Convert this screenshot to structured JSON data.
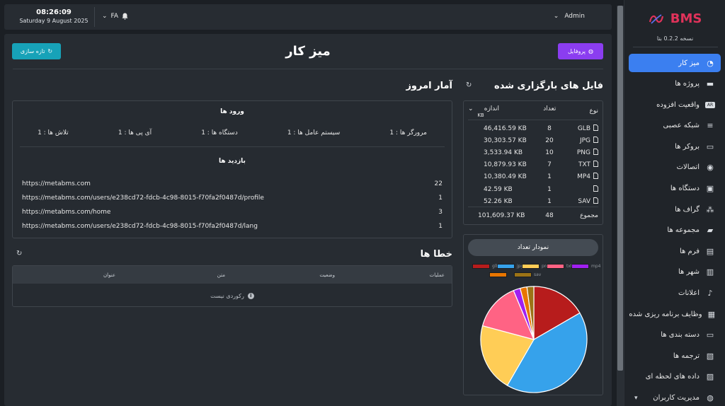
{
  "app": {
    "brand": "BMS",
    "version_label": "نسخه 0.2.2 بتا"
  },
  "topbar": {
    "time": "08:26:09",
    "date": "Saturday 9 August 2025",
    "lang": "FA",
    "user": "Admin"
  },
  "sidebar": {
    "items": [
      {
        "label": "میز کار",
        "icon": "pie-chart-icon",
        "glyph": "◔",
        "active": true
      },
      {
        "label": "پروژه ها",
        "icon": "briefcase-icon",
        "glyph": "▬"
      },
      {
        "label": "واقعیت افزوده",
        "icon": "ar-icon",
        "glyph": "AR"
      },
      {
        "label": "شبکه عصبی",
        "icon": "database-icon",
        "glyph": "≡"
      },
      {
        "label": "بروکر ها",
        "icon": "router-icon",
        "glyph": "▭"
      },
      {
        "label": "اتصالات",
        "icon": "connection-icon",
        "glyph": "◉"
      },
      {
        "label": "دستگاه ها",
        "icon": "device-icon",
        "glyph": "▣"
      },
      {
        "label": "گراف ها",
        "icon": "graph-icon",
        "glyph": "⁂"
      },
      {
        "label": "مجموعه ها",
        "icon": "folder-icon",
        "glyph": "▰"
      },
      {
        "label": "فرم ها",
        "icon": "form-icon",
        "glyph": "▤"
      },
      {
        "label": "شهر ها",
        "icon": "map-icon",
        "glyph": "▥"
      },
      {
        "label": "اعلانات",
        "icon": "bell-icon",
        "glyph": "♪"
      },
      {
        "label": "وظایف برنامه ریزی شده",
        "icon": "calendar-icon",
        "glyph": "▦"
      },
      {
        "label": "دسته بندی ها",
        "icon": "folder-open-icon",
        "glyph": "▭"
      },
      {
        "label": "ترجمه ها",
        "icon": "translate-icon",
        "glyph": "▧"
      },
      {
        "label": "داده های لحظه ای",
        "icon": "message-icon",
        "glyph": "▨"
      },
      {
        "label": "مدیریت کاربران",
        "icon": "user-circle-icon",
        "glyph": "◍",
        "chevron": "▾"
      }
    ]
  },
  "main": {
    "title": "میز کار",
    "refresh_label": "تازه سازی",
    "profile_label": "پروفایل"
  },
  "stats": {
    "title": "آمار امروز",
    "logins_title": "ورود ها",
    "logins": [
      "تلاش ها : 1",
      "آی پی ها : 1",
      "دستگاه ها : 1",
      "سیستم عامل ها : 1",
      "مرورگر ها : 1"
    ],
    "visits_title": "بازدید ها",
    "visits": [
      {
        "url": "https://metabms.com",
        "count": "22"
      },
      {
        "url": "https://metabms.com/users/e238cd72-fdcb-4c98-8015-f70fa2f0487d/profile",
        "count": "1"
      },
      {
        "url": "https://metabms.com/home",
        "count": "3"
      },
      {
        "url": "https://metabms.com/users/e238cd72-fdcb-4c98-8015-f70fa2f0487d/lang",
        "count": "1"
      }
    ]
  },
  "errors": {
    "title": "خطا ها",
    "columns": [
      "عنوان",
      "متن",
      "وضعیت",
      "عملیات"
    ],
    "empty_text": "رکوردی نیست"
  },
  "files": {
    "title": "فایل های بارگزاری شده",
    "headers": {
      "type": "نوع",
      "count": "تعداد",
      "size": "اندازه",
      "unit": "KB"
    },
    "rows": [
      {
        "type": "GLB",
        "count": "8",
        "size": "46,416.59 KB"
      },
      {
        "type": "JPG",
        "count": "20",
        "size": "30,303.57 KB"
      },
      {
        "type": "PNG",
        "count": "10",
        "size": "3,533.94 KB"
      },
      {
        "type": "TXT",
        "count": "7",
        "size": "10,879.93 KB"
      },
      {
        "type": "MP4",
        "count": "1",
        "size": "10,380.49 KB"
      },
      {
        "type": "",
        "count": "1",
        "size": "42.59 KB"
      },
      {
        "type": "SAV",
        "count": "1",
        "size": "52.26 KB"
      }
    ],
    "total": {
      "label": "مجموع",
      "count": "48",
      "size": "101,609.37 KB"
    }
  },
  "chart_data": {
    "type": "pie",
    "title": "نمودار تعداد",
    "categories": [
      "glb",
      "jpg",
      "png",
      "txt",
      "mp4",
      "",
      "sav"
    ],
    "values": [
      8,
      20,
      10,
      7,
      1,
      1,
      1
    ],
    "colors": [
      "#b71c1c",
      "#36a2eb",
      "#ffcd56",
      "#ff6384",
      "#a020f0",
      "#e87500",
      "#9c7316"
    ],
    "legend_position": "top"
  }
}
